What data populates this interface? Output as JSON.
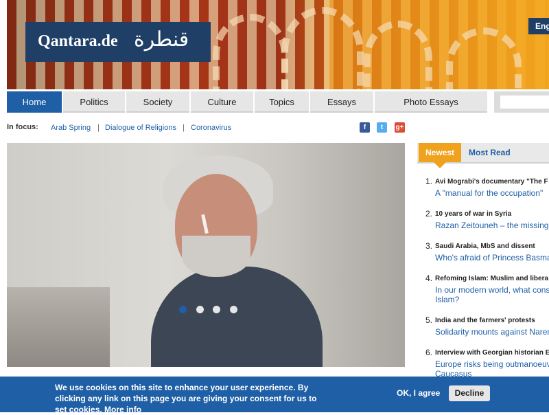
{
  "header": {
    "logo_latin": "Qantara.de",
    "logo_arabic": "قنطرة",
    "language_button": "English"
  },
  "nav": {
    "items": [
      "Home",
      "Politics",
      "Society",
      "Culture",
      "Topics",
      "Essays",
      "Photo Essays"
    ],
    "active": "Home",
    "search_value": ""
  },
  "focus": {
    "label": "In focus:",
    "links": [
      "Arab Spring",
      "Dialogue of Religions",
      "Coronavirus"
    ],
    "separator": "|"
  },
  "social": {
    "icons": [
      "facebook-icon",
      "twitter-icon",
      "google-plus-icon"
    ],
    "glyphs": [
      "f",
      "t",
      "g+"
    ],
    "colors": [
      "#3b5998",
      "#55acee",
      "#dd4b39"
    ]
  },
  "carousel": {
    "dot_count": 4,
    "active_dot": 1
  },
  "sidebar": {
    "tabs": [
      "Newest",
      "Most Read"
    ],
    "items": [
      {
        "num": "1.",
        "kicker": "Avi Mograbi's documentary \"The F",
        "title": "A \"manual for the occupation\""
      },
      {
        "num": "2.",
        "kicker": "10 years of war in Syria",
        "title": "Razan Zeitouneh – the missing"
      },
      {
        "num": "3.",
        "kicker": "Saudi Arabia, MbS and dissent",
        "title": "Who's afraid of Princess Basma"
      },
      {
        "num": "4.",
        "kicker": "Refoming Islam: Muslim and libera",
        "title": "In our modern world, what cons Islam?"
      },
      {
        "num": "5.",
        "kicker": "India and the farmers' protests",
        "title": "Solidarity mounts against Naren"
      },
      {
        "num": "6.",
        "kicker": "Interview with Georgian historian E",
        "title": "Europe risks being outmanoeuv Caucasus"
      }
    ]
  },
  "cookie": {
    "text": "We use cookies on this site to enhance your user experience. By clicking any link on this page you are giving your consent for us to set cookies.",
    "more_info": "More info",
    "ok_label": "OK, I agree",
    "decline_label": "Decline"
  },
  "colors": {
    "brand_blue": "#1f5fa6",
    "logo_navy": "#1f3f66",
    "accent_orange": "#f0a21c"
  }
}
